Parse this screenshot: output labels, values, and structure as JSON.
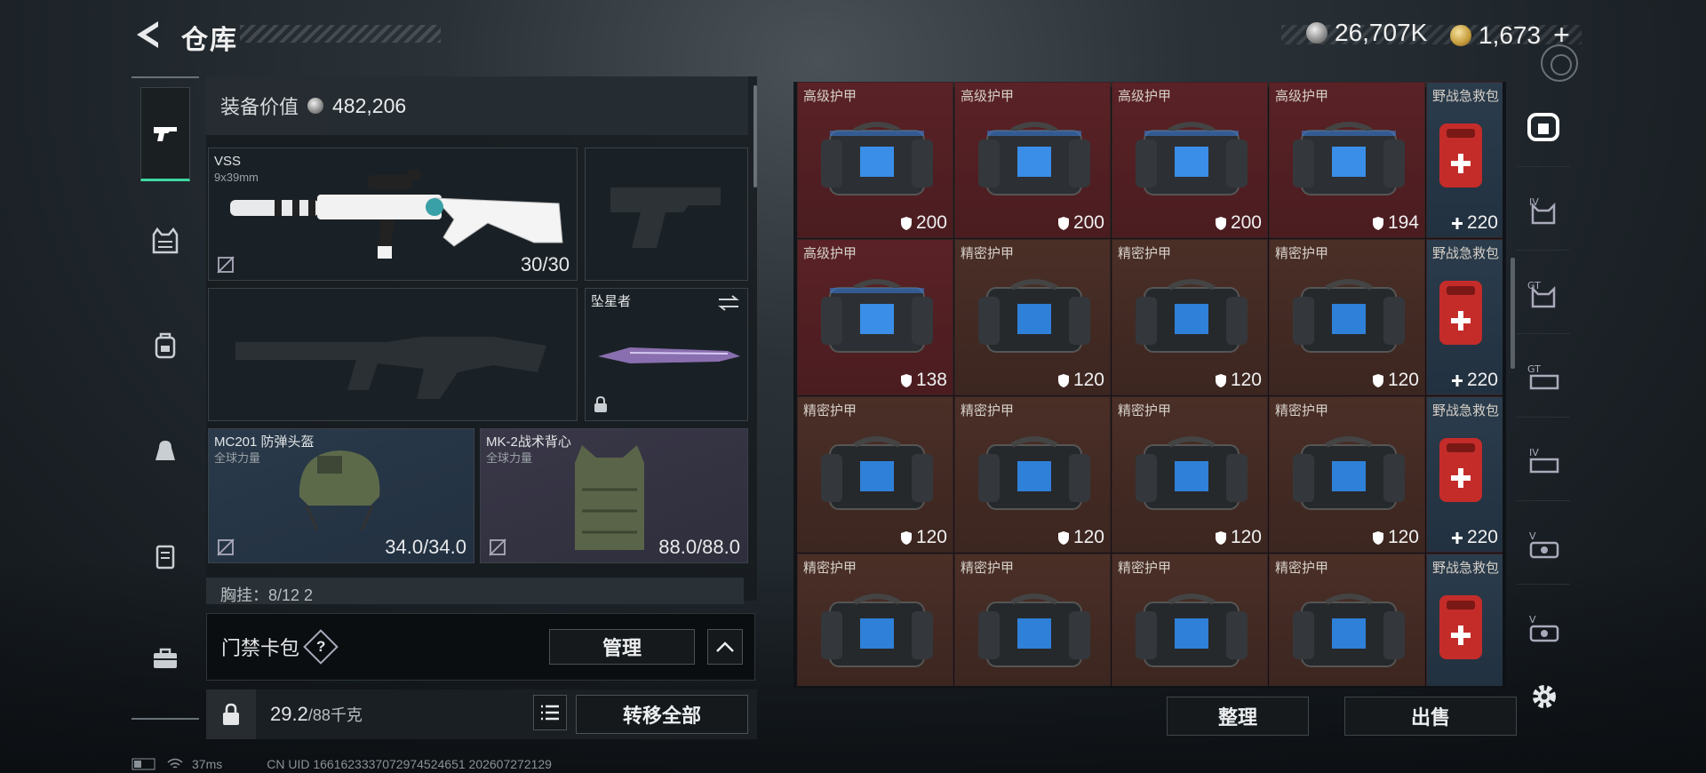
{
  "header": {
    "title": "仓库",
    "currency_silver": "26,707K",
    "currency_gold": "1,673",
    "plus": "+"
  },
  "loadout": {
    "value_label": "装备价值",
    "value": "482,206",
    "primary": {
      "name": "VSS",
      "caliber": "9x39mm",
      "ammo": "30/30"
    },
    "melee": {
      "name": "坠星者"
    },
    "helmet": {
      "name": "MC201 防弹头盔",
      "brand": "全球力量",
      "durability": "34.0/34.0"
    },
    "vest": {
      "name": "MK-2战术背心",
      "brand": "全球力量",
      "durability": "88.0/88.0"
    },
    "chest_rig": "胸挂：8/12 2"
  },
  "keycard": {
    "label": "门禁卡包",
    "help": "?",
    "manage": "管理"
  },
  "weight": {
    "current": "29.2",
    "max": "/88千克"
  },
  "transfer_all": "转移全部",
  "grid": {
    "rows": [
      [
        {
          "name": "高级护甲",
          "value": "200",
          "type": "red",
          "icon": "shield"
        },
        {
          "name": "高级护甲",
          "value": "200",
          "type": "red",
          "icon": "shield"
        },
        {
          "name": "高级护甲",
          "value": "200",
          "type": "red",
          "icon": "shield"
        },
        {
          "name": "高级护甲",
          "value": "194",
          "type": "red",
          "icon": "shield"
        },
        {
          "name": "野战急救包",
          "value": "220",
          "type": "med",
          "icon": "plus"
        }
      ],
      [
        {
          "name": "高级护甲",
          "value": "138",
          "type": "red",
          "icon": "shield"
        },
        {
          "name": "精密护甲",
          "value": "120",
          "type": "brown",
          "icon": "shield"
        },
        {
          "name": "精密护甲",
          "value": "120",
          "type": "brown",
          "icon": "shield"
        },
        {
          "name": "精密护甲",
          "value": "120",
          "type": "brown",
          "icon": "shield"
        },
        {
          "name": "野战急救包",
          "value": "220",
          "type": "med",
          "icon": "plus"
        }
      ],
      [
        {
          "name": "精密护甲",
          "value": "120",
          "type": "brown",
          "icon": "shield"
        },
        {
          "name": "精密护甲",
          "value": "120",
          "type": "brown",
          "icon": "shield"
        },
        {
          "name": "精密护甲",
          "value": "120",
          "type": "brown",
          "icon": "shield"
        },
        {
          "name": "精密护甲",
          "value": "120",
          "type": "brown",
          "icon": "shield"
        },
        {
          "name": "野战急救包",
          "value": "220",
          "type": "med",
          "icon": "plus"
        }
      ],
      [
        {
          "name": "精密护甲",
          "value": "",
          "type": "brown",
          "icon": "shield"
        },
        {
          "name": "精密护甲",
          "value": "",
          "type": "brown",
          "icon": "shield"
        },
        {
          "name": "精密护甲",
          "value": "",
          "type": "brown",
          "icon": "shield"
        },
        {
          "name": "精密护甲",
          "value": "",
          "type": "brown",
          "icon": "shield"
        },
        {
          "name": "野战急救包",
          "value": "",
          "type": "med",
          "icon": "plus"
        }
      ]
    ]
  },
  "buttons": {
    "sort": "整理",
    "sell": "出售"
  },
  "right_nav": [
    "safe-box-icon",
    "IV-armor-icon",
    "GT-armor-icon",
    "GT-rig-icon",
    "IV-rig-icon",
    "V-bag-icon",
    "V-bag-icon-2"
  ],
  "status": {
    "ping": "37ms",
    "uid": "CN UID 1661623337072974524651 202607272129"
  },
  "colors": {
    "accent": "#3fd8a0",
    "red_rarity": "#5a2226",
    "brown_rarity": "#4a2f27",
    "blue_rarity": "#2b3c4c"
  }
}
